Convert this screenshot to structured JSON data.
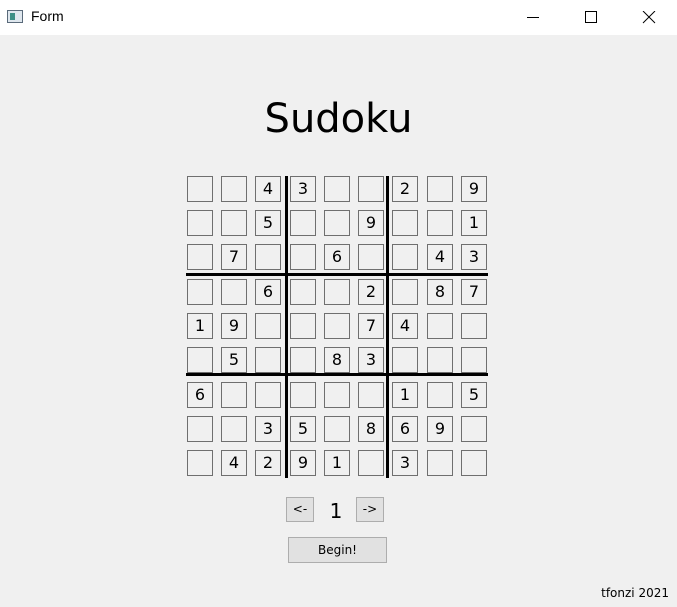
{
  "window": {
    "title": "Form"
  },
  "heading": "Sudoku",
  "grid": [
    [
      "",
      "",
      "4",
      "3",
      "",
      "",
      "2",
      "",
      "9"
    ],
    [
      "",
      "",
      "5",
      "",
      "",
      "9",
      "",
      "",
      "1"
    ],
    [
      "",
      "7",
      "",
      "",
      "6",
      "",
      "",
      "4",
      "3"
    ],
    [
      "",
      "",
      "6",
      "",
      "",
      "2",
      "",
      "8",
      "7"
    ],
    [
      "1",
      "9",
      "",
      "",
      "",
      "7",
      "4",
      "",
      ""
    ],
    [
      "",
      "5",
      "",
      "",
      "8",
      "3",
      "",
      "",
      ""
    ],
    [
      "6",
      "",
      "",
      "",
      "",
      "",
      "1",
      "",
      "5"
    ],
    [
      "",
      "",
      "3",
      "5",
      "",
      "8",
      "6",
      "9",
      ""
    ],
    [
      "",
      "4",
      "2",
      "9",
      "1",
      "",
      "3",
      "",
      ""
    ]
  ],
  "nav": {
    "prev_label": "<-",
    "next_label": "->",
    "puzzle_number": "1"
  },
  "begin_label": "Begin!",
  "credit": "tfonzi 2021"
}
